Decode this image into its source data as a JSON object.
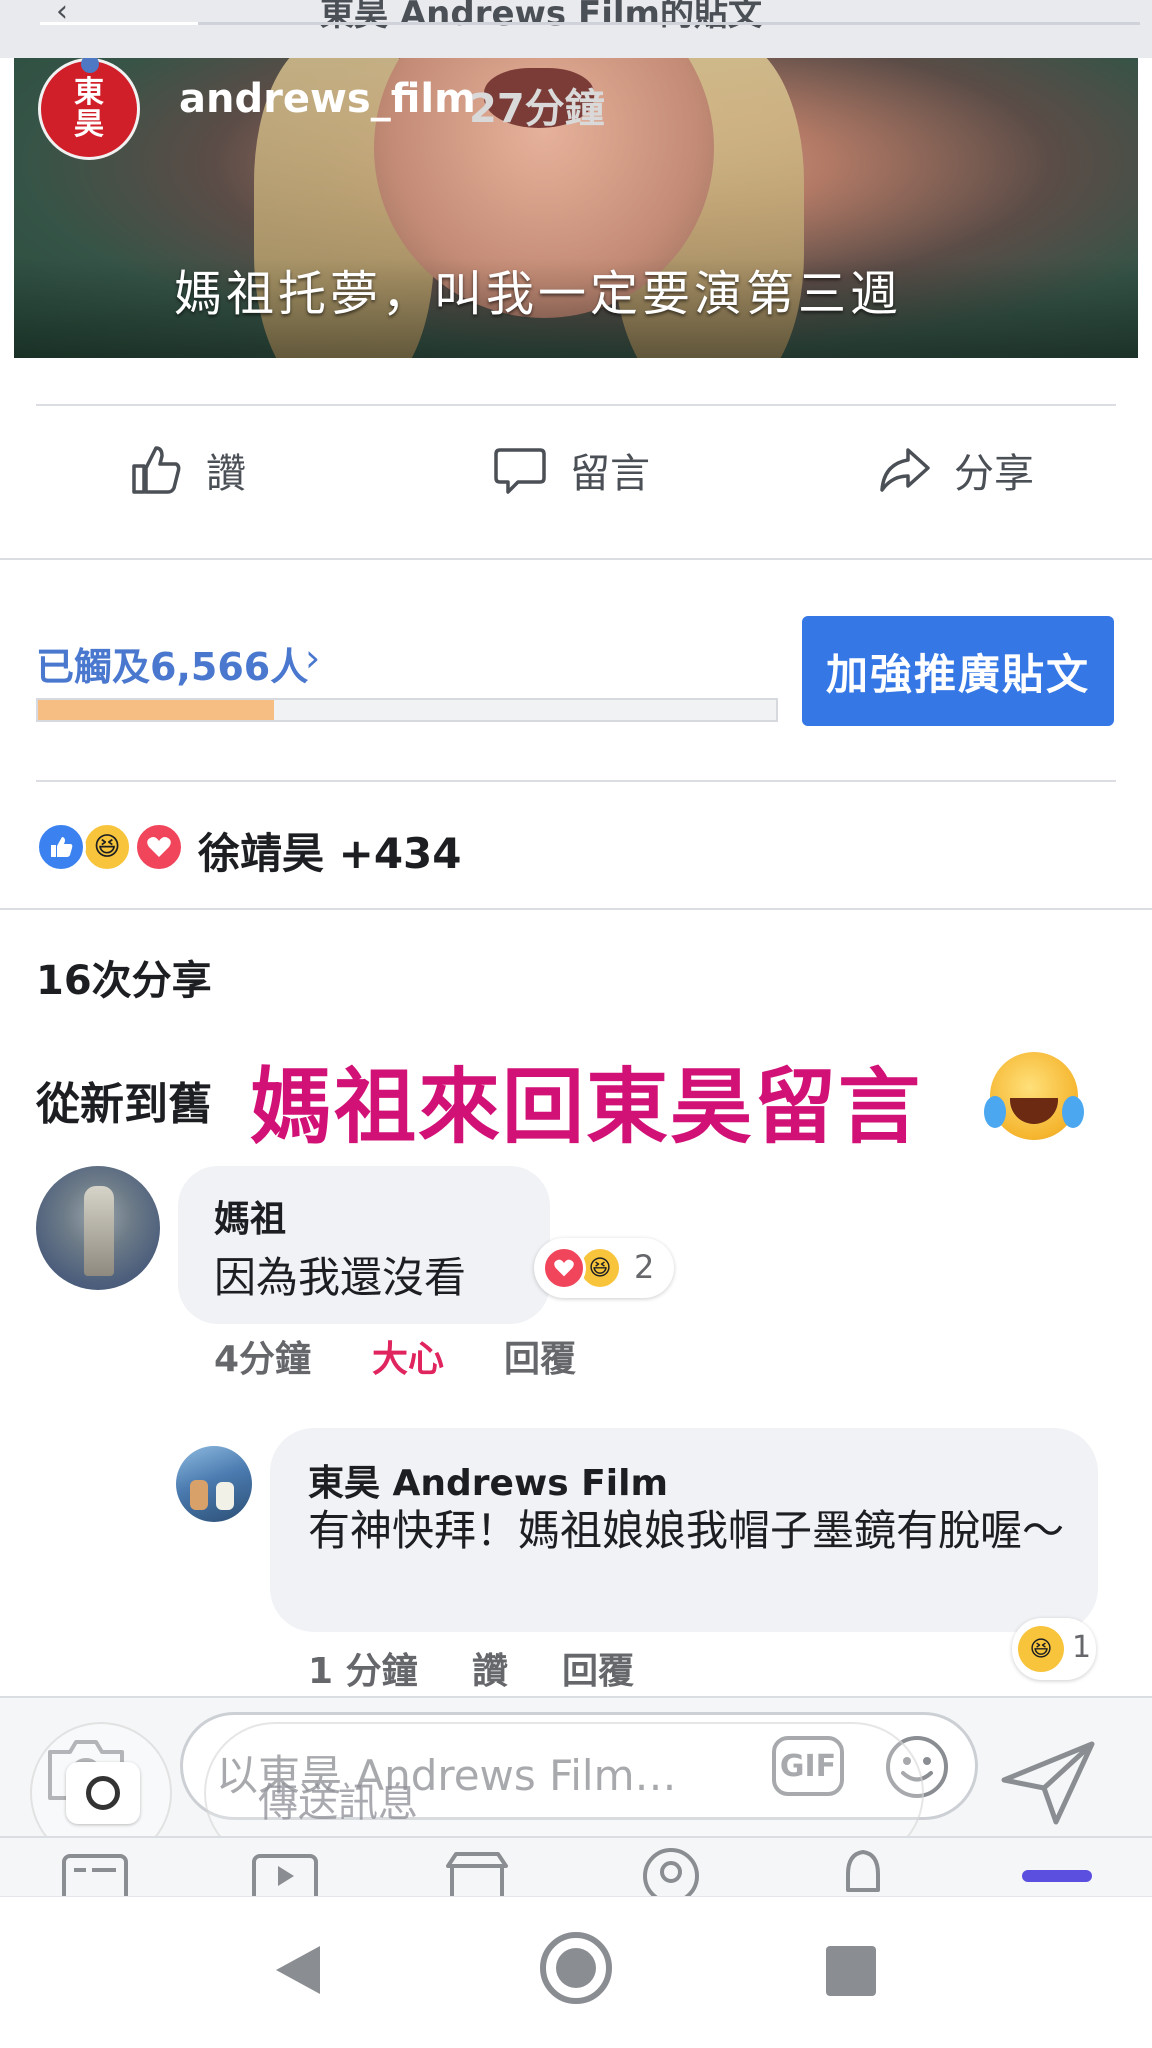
{
  "header": {
    "title": "東昊 Andrews Film的貼文",
    "back_icon": "back-arrow-icon"
  },
  "story": {
    "avatar_text": "東\n昊",
    "username": "andrews_film",
    "time": "27分鐘",
    "subtitle": "媽祖托夢，叫我一定要演第三週"
  },
  "actions": {
    "like": "讚",
    "comment": "留言",
    "share": "分享"
  },
  "reach": {
    "text": "已觸及6,566人",
    "arrow": "›",
    "progress_fraction": 0.32
  },
  "boost_button": "加強推廣貼文",
  "reactions": {
    "summary": "徐靖昊 +434",
    "icons": [
      "like-icon",
      "haha-icon",
      "love-icon"
    ]
  },
  "shares": "16次分享",
  "sort_label": "從新到舊",
  "overlay_caption": "媽祖來回東昊留言",
  "comments": [
    {
      "author": "媽祖",
      "text": "因為我還沒看",
      "reaction_count": "2",
      "time": "4分鐘",
      "reaction_label": "大心",
      "reply_label": "回覆"
    },
    {
      "author": "東昊 Andrews Film",
      "text": "有神快拜！媽祖娘娘我帽子墨鏡有脫喔～",
      "reaction_count": "1",
      "time": "1 分鐘",
      "like_label": "讚",
      "reply_label": "回覆"
    }
  ],
  "composer": {
    "placeholder": "以東昊 Andrews Film…",
    "gif_label": "GIF",
    "float_placeholder": "傳送訊息"
  },
  "colors": {
    "accent": "#3578e5",
    "reach_text": "#4a78cf",
    "reach_fill": "#f7be83",
    "overlay_caption": "#d21176",
    "love_reaction": "#f0455b",
    "active_tab": "#5b4fe0"
  }
}
